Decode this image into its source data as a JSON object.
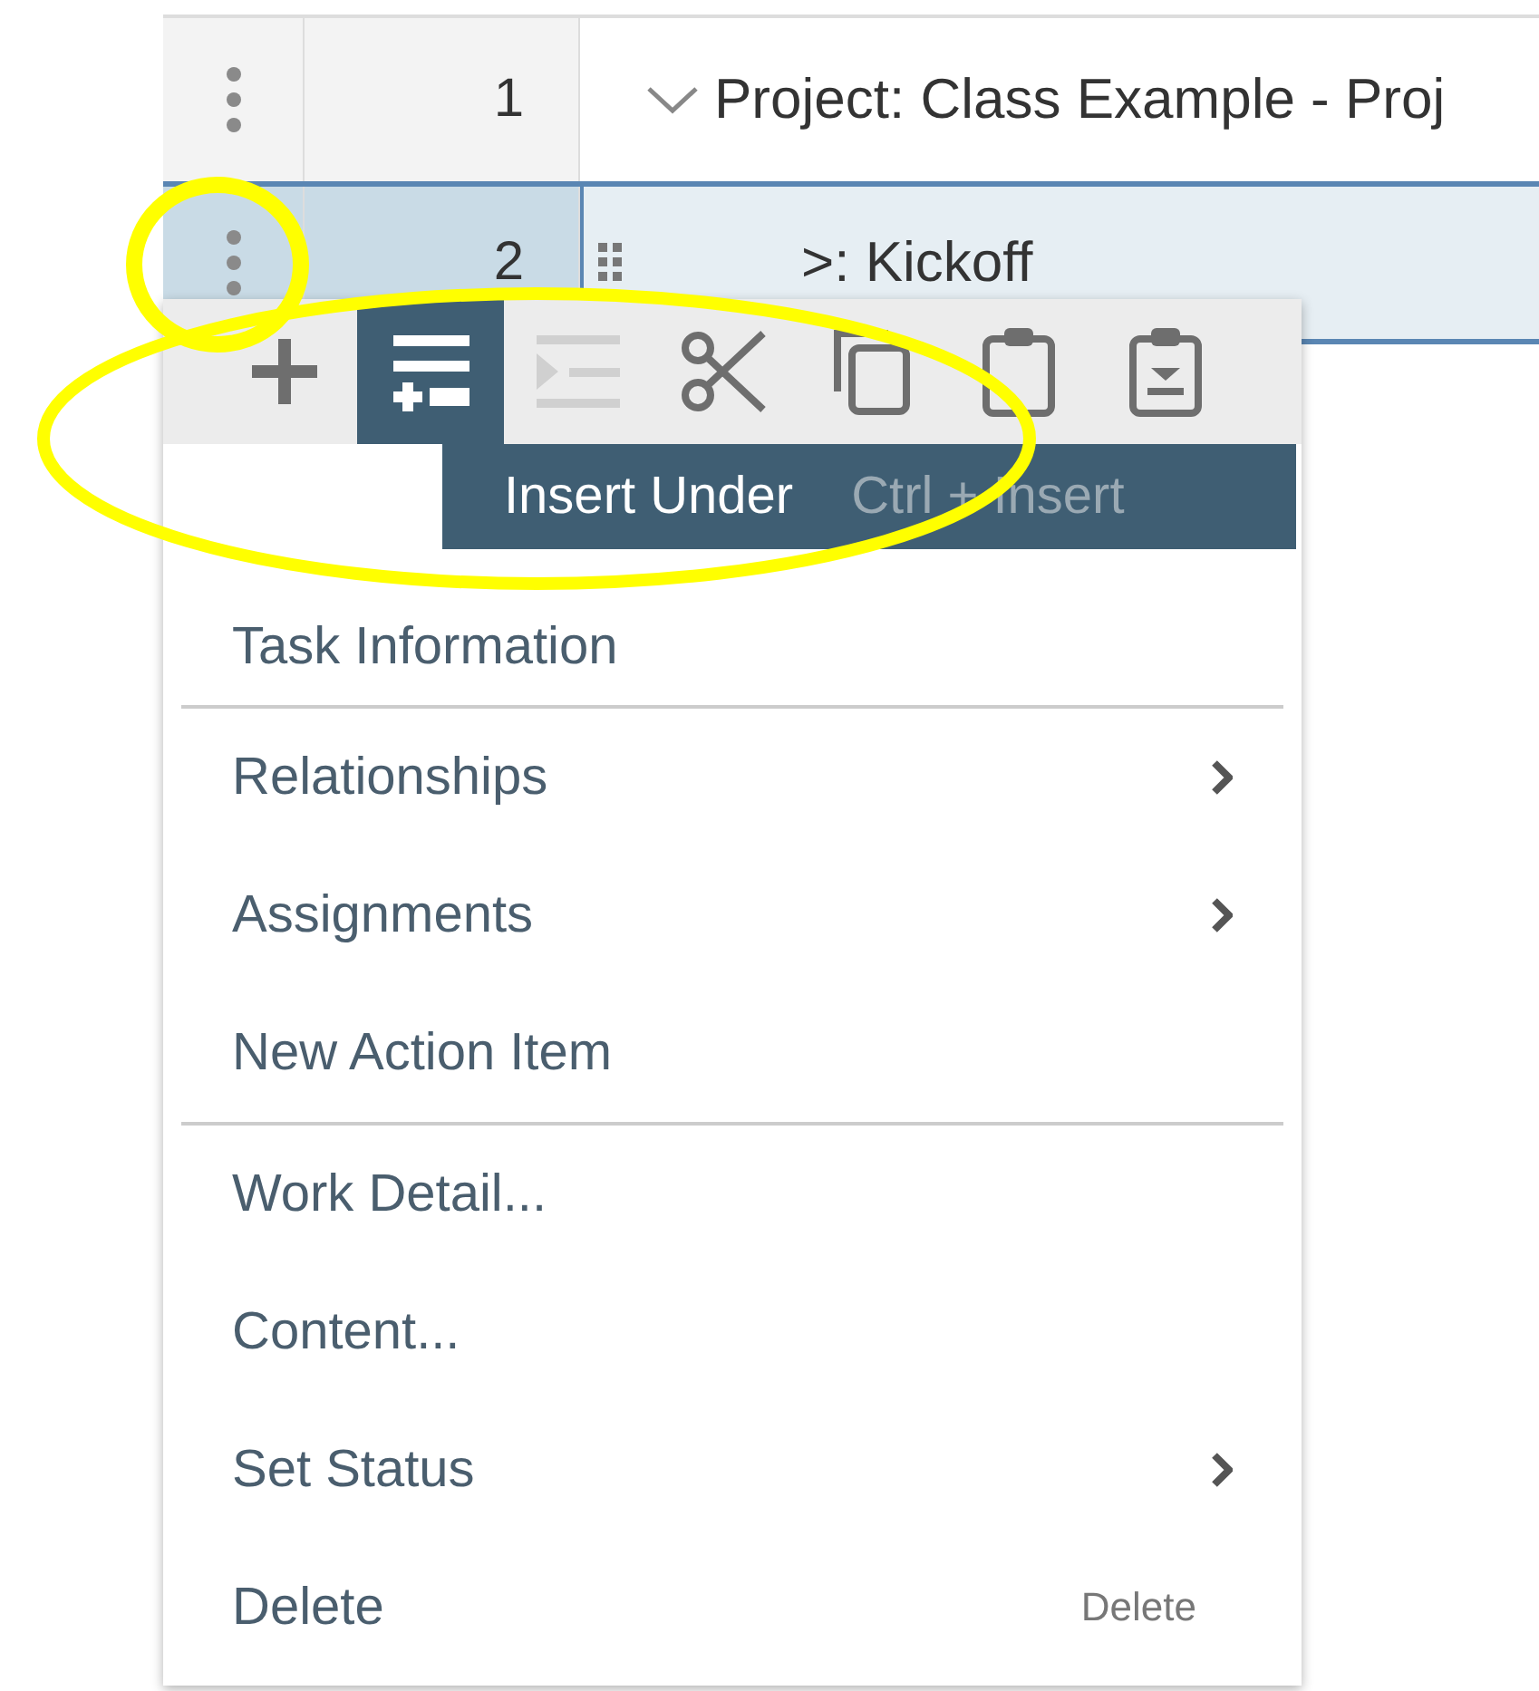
{
  "rows": [
    {
      "number": "1",
      "title": "Project: Class Example - Proj",
      "expanded": true,
      "selected": false
    },
    {
      "number": "2",
      "title": ">: Kickoff",
      "selected": true
    }
  ],
  "toolbar": [
    {
      "kind": "add",
      "selected": false,
      "disabled": false
    },
    {
      "kind": "insert-under",
      "selected": true,
      "disabled": false
    },
    {
      "kind": "indent",
      "selected": false,
      "disabled": true
    },
    {
      "kind": "cut",
      "selected": false,
      "disabled": false
    },
    {
      "kind": "copy",
      "selected": false,
      "disabled": false
    },
    {
      "kind": "paste",
      "selected": false,
      "disabled": false
    },
    {
      "kind": "paste-under",
      "selected": false,
      "disabled": false
    }
  ],
  "tooltip": {
    "label": "Insert Under",
    "shortcut": "Ctrl + Insert"
  },
  "menu_groups": [
    [
      {
        "label": "Task Information",
        "submenu": false
      }
    ],
    [
      {
        "label": "Relationships",
        "submenu": true
      },
      {
        "label": "Assignments",
        "submenu": true
      },
      {
        "label": "New Action Item",
        "submenu": false
      }
    ],
    [
      {
        "label": "Work Detail...",
        "submenu": false
      },
      {
        "label": "Content...",
        "submenu": false
      },
      {
        "label": "Set Status",
        "submenu": true
      },
      {
        "label": "Delete",
        "submenu": false,
        "shortcut": "Delete"
      }
    ]
  ]
}
